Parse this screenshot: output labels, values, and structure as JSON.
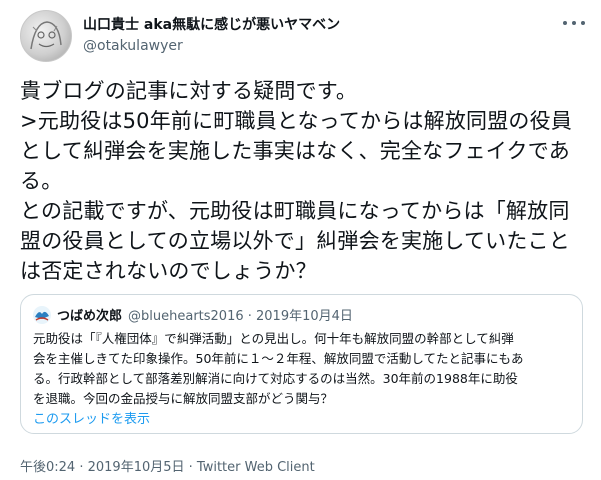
{
  "author": {
    "display_name": "山口貴士 aka無駄に感じが悪いヤマベン",
    "handle": "@otakulawyer"
  },
  "tweet": {
    "lines": [
      "貴ブログの記事に対する疑問です。",
      ">元助役は50年前に町職員となってからは解放同盟の役員",
      "として糾弾会を実施した事実はなく、完全なフェイクであ",
      "る。",
      "との記載ですが、元助役は町職員になってからは「解放同",
      "盟の役員としての立場以外で」糾弾会を実施していたこと",
      "は否定されないのでしょうか？"
    ]
  },
  "quoted": {
    "name": "つばめ次郎",
    "meta": "@bluehearts2016 · 2019年10月4日",
    "lines": [
      "元助役は「『人権団体』で糾弾活動」との見出し。何十年も解放同盟の幹部として糾弾",
      "会を主催しきてた印象操作。50年前に１〜２年程、解放同盟で活動してたと記事にもあ",
      "る。行政幹部として部落差別解消に向けて対応するのは当然。30年前の1988年に助役",
      "を退職。今回の金品授与に解放同盟支部がどう関与？"
    ],
    "thread_link": "このスレッドを表示"
  },
  "footer": {
    "time": "午後0:24",
    "date": "2019年10月5日",
    "client": "Twitter Web Client"
  }
}
